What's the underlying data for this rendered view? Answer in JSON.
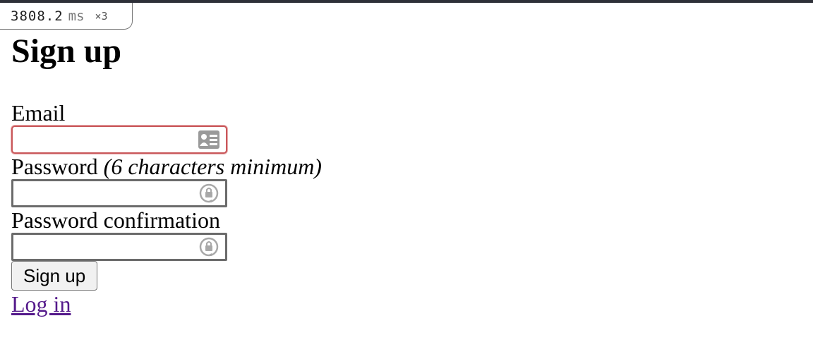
{
  "profiler": {
    "value": "3808.2",
    "unit": "ms",
    "count": "×3"
  },
  "page": {
    "title": "Sign up"
  },
  "form": {
    "email": {
      "label": "Email",
      "value": "",
      "icon": "contact-card-icon"
    },
    "password": {
      "label": "Password",
      "hint": "(6 characters minimum)",
      "value": "",
      "icon": "password-autofill-icon"
    },
    "password_confirmation": {
      "label": "Password confirmation",
      "value": "",
      "icon": "password-autofill-icon"
    },
    "submit_label": "Sign up"
  },
  "links": {
    "login": "Log in"
  },
  "colors": {
    "topbar": "#2e3038",
    "invalid_border": "#c9575a",
    "visited_link": "#551a8b"
  }
}
